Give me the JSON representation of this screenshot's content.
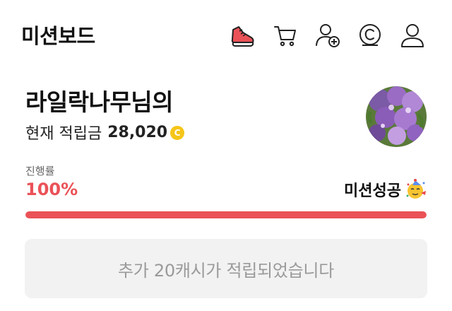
{
  "header": {
    "title": "미션보드",
    "icons": [
      "sneaker-icon",
      "cart-icon",
      "add-friend-icon",
      "cash-coin-icon",
      "user-profile-icon"
    ]
  },
  "profile": {
    "name": "라일락나무님의",
    "points_label": "현재 적립금",
    "points_value": "28,020",
    "coin_symbol": "C",
    "avatar": "lilac-flowers-photo"
  },
  "progress": {
    "label": "진행률",
    "percent_text": "100%",
    "fraction": 1.0,
    "status_text": "미션성공",
    "status_icon": "party-face-emoji"
  },
  "reward": {
    "message": "추가 20캐시가 적립되었습니다"
  },
  "colors": {
    "accent": "#ea5257",
    "coin": "#f5c518",
    "reward_bg": "#f2f2f2",
    "muted_text": "#9a9a9a"
  }
}
